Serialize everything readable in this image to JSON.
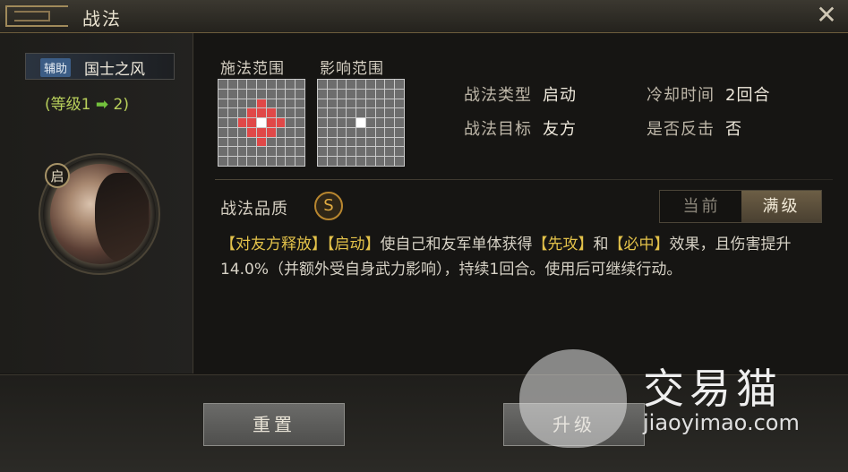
{
  "window": {
    "title": "战法",
    "close_icon": "close-icon"
  },
  "skill": {
    "badge": "辅助",
    "name": "国士之风",
    "level_prefix": "(等级1",
    "level_arrow": "➡",
    "level_suffix": "2)",
    "type_badge": "启"
  },
  "ranges": {
    "cast_label": "施法范围",
    "effect_label": "影响范围",
    "cast_red_cells": [
      [
        2,
        4
      ],
      [
        3,
        3
      ],
      [
        3,
        4
      ],
      [
        3,
        5
      ],
      [
        4,
        2
      ],
      [
        4,
        3
      ],
      [
        4,
        5
      ],
      [
        4,
        6
      ],
      [
        5,
        3
      ],
      [
        5,
        4
      ],
      [
        5,
        5
      ],
      [
        6,
        4
      ]
    ],
    "cast_white_cells": [
      [
        4,
        4
      ]
    ],
    "effect_white_cells": [
      [
        4,
        4
      ]
    ]
  },
  "info": {
    "type_label": "战法类型",
    "type_value": "启动",
    "target_label": "战法目标",
    "target_value": "友方",
    "cooldown_label": "冷却时间",
    "cooldown_value": "2回合",
    "counter_label": "是否反击",
    "counter_value": "否"
  },
  "quality": {
    "label": "战法品质",
    "grade": "S"
  },
  "toggle": {
    "current": "当前",
    "max": "满级"
  },
  "description": {
    "p1": "【对友方释放】",
    "p2": "【启动】",
    "p3": "使自己和友军单体获得",
    "p4": "【先攻】",
    "p5": "和",
    "p6": "【必中】",
    "p7": "效果，且伤害提升14.0%（并额外受自身武力影响），持续1回合。使用后可继续行动。"
  },
  "buttons": {
    "reset": "重置",
    "upgrade": "升级"
  },
  "watermark": {
    "text": "交易猫",
    "url": "jiaoyimao.com"
  }
}
